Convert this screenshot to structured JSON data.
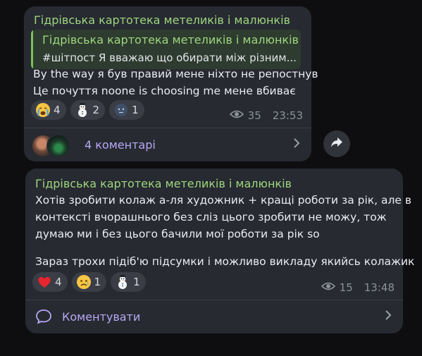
{
  "post1": {
    "channel": "Гідрівська картотека метеликів і малюнків",
    "reply": {
      "title": "Гідрівська картотека метеликів і малюнків",
      "text": "#шітпост  Я вважаю що обирати між різним..."
    },
    "lines": [
      "By the way я був правий мене ніхто не репостнув",
      "Це почуття noone is choosing me мене вбиває"
    ],
    "reactions": [
      {
        "emoji": "crying-face",
        "count": "4"
      },
      {
        "emoji": "snowman",
        "count": "2"
      },
      {
        "emoji": "face",
        "count": "1"
      }
    ],
    "views": "35",
    "time": "23:53",
    "comments_label": "4 коментарі"
  },
  "post2": {
    "channel": "Гідрівська картотека метеликів і малюнків",
    "lines": [
      "Хотів зробити колаж а-ля художник + кращі роботи за рік, але в",
      "контексті вчорашнього без сліз цього зробити не можу, тож",
      "думаю ми і без цього бачили мої роботи за рік so",
      "",
      "Зараз трохи підіб'ю підсумки і можливо викладу якийсь колажик"
    ],
    "reactions": [
      {
        "emoji": "red-heart",
        "count": "4"
      },
      {
        "emoji": "sad-face",
        "count": "1"
      },
      {
        "emoji": "snowman",
        "count": "1"
      }
    ],
    "views": "15",
    "time": "13:48",
    "comment_label": "Коментувати"
  },
  "colors": {
    "background": "#0e0e10",
    "bubble": "#272a31",
    "channel_name": "#9ed67f",
    "link": "#b7a8f5"
  }
}
